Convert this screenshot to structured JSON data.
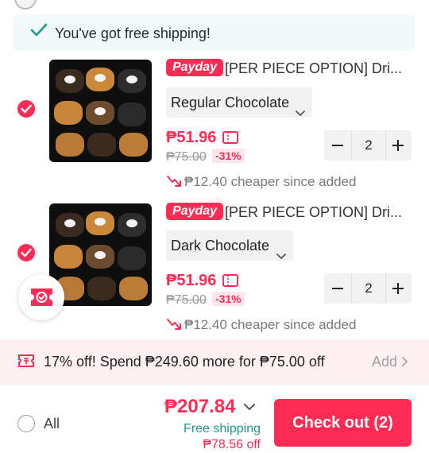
{
  "shipping": {
    "message": "You've got free shipping!"
  },
  "items": [
    {
      "badge": "Payday",
      "title": "[PER PIECE OPTION] Dri...",
      "variant": "Regular Chocolate",
      "price": "₱51.96",
      "original_price": "₱75.00",
      "discount": "-31%",
      "quantity": "2",
      "price_drop": "₱12.40 cheaper since added",
      "selected": true
    },
    {
      "badge": "Payday",
      "title": "[PER PIECE OPTION] Dri...",
      "variant": "Dark Chocolate",
      "price": "₱51.96",
      "original_price": "₱75.00",
      "discount": "-31%",
      "quantity": "2",
      "price_drop": "₱12.40 cheaper since added",
      "selected": true
    }
  ],
  "promo": {
    "text": "17% off! Spend ₱249.60 more for ₱75.00 off",
    "action": "Add"
  },
  "footer": {
    "select_all_label": "All",
    "total": "₱207.84",
    "free_shipping": "Free shipping",
    "savings": "₱78.56 off",
    "checkout_label": "Check out (2)"
  },
  "colors": {
    "accent": "#fe2c55",
    "shipping_bg": "#f2f9fa",
    "promo_bg": "#fff1f3",
    "teal": "#1a9b8a"
  },
  "icons": [
    "checkmark-icon",
    "coupon-icon",
    "price-drop-icon",
    "chevron-down-icon",
    "minus-icon",
    "plus-icon",
    "voucher-icon",
    "chevron-right-icon"
  ]
}
